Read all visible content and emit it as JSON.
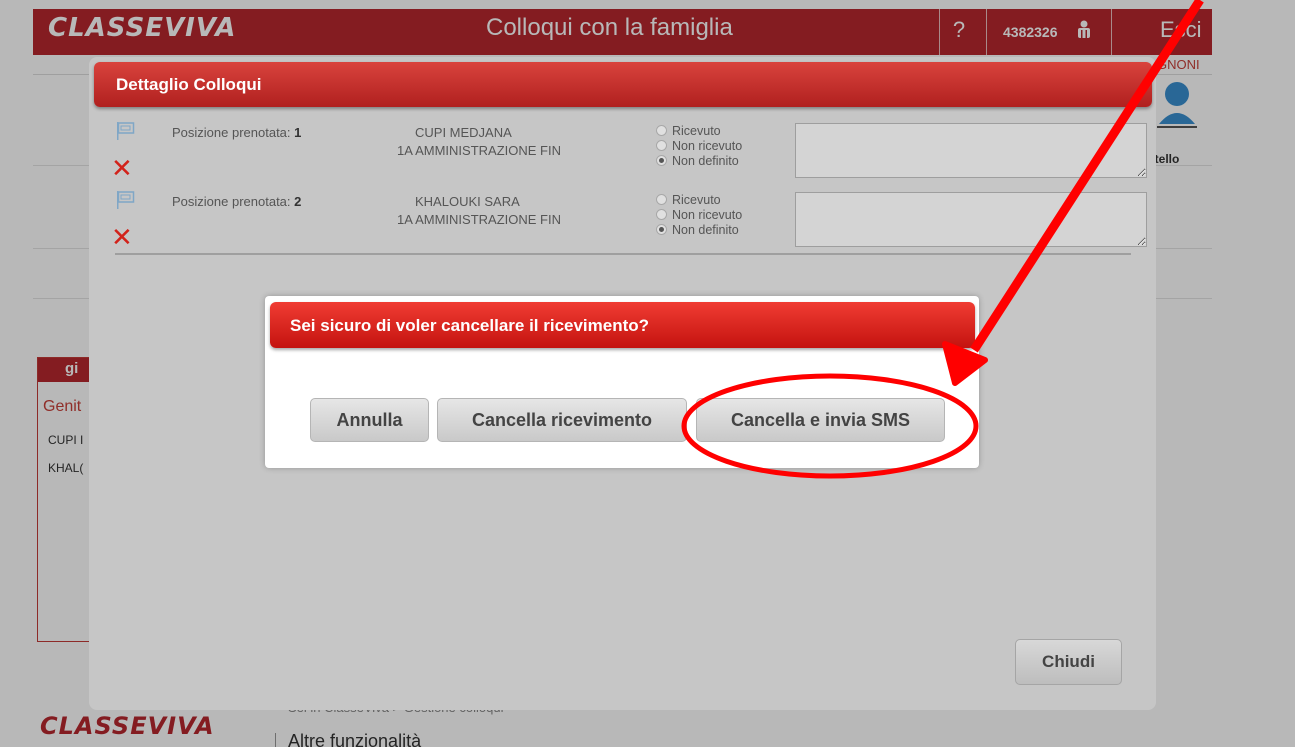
{
  "app": {
    "logo_prefix": "CLASSE",
    "logo_suffix": "VIVA",
    "title": "Colloqui con la famiglia",
    "help_label": "?",
    "user_code": "4382326",
    "logout_label": "Esci"
  },
  "background": {
    "teacher_name": "GNONI",
    "sportello_label": "rtello",
    "side_panel_title": "gi",
    "side_panel_subtitle": "Genit",
    "side_rows": [
      "CUPI I",
      "KHAL("
    ],
    "footer_logo_prefix": "CLASSE",
    "footer_logo_suffix": "VIVA",
    "footer_crumb": "Sei in ClasseViva > Gestione colloqui",
    "footer_title": "Altre funzionalità"
  },
  "detail_dialog": {
    "title": "Dettaglio Colloqui",
    "position_prefix": "Posizione prenotata:",
    "appointments": [
      {
        "position": "1",
        "student": "CUPI MEDJANA",
        "class": "1A AMMINISTRAZIONE FIN",
        "options": [
          "Ricevuto",
          "Non ricevuto",
          "Non definito"
        ],
        "selected": "Non definito",
        "note": ""
      },
      {
        "position": "2",
        "student": "KHALOUKI SARA",
        "class": "1A AMMINISTRAZIONE FIN",
        "options": [
          "Ricevuto",
          "Non ricevuto",
          "Non definito"
        ],
        "selected": "Non definito",
        "note": ""
      }
    ],
    "close_label": "Chiudi"
  },
  "confirm_dialog": {
    "title": "Sei sicuro di voler cancellare il ricevimento?",
    "cancel_label": "Annulla",
    "delete_label": "Cancella ricevimento",
    "delete_sms_label": "Cancella e invia SMS"
  },
  "annotation": {
    "color": "#ff0000"
  },
  "colors": {
    "brand_red": "#b7282e",
    "header_red": "#d9433d"
  }
}
